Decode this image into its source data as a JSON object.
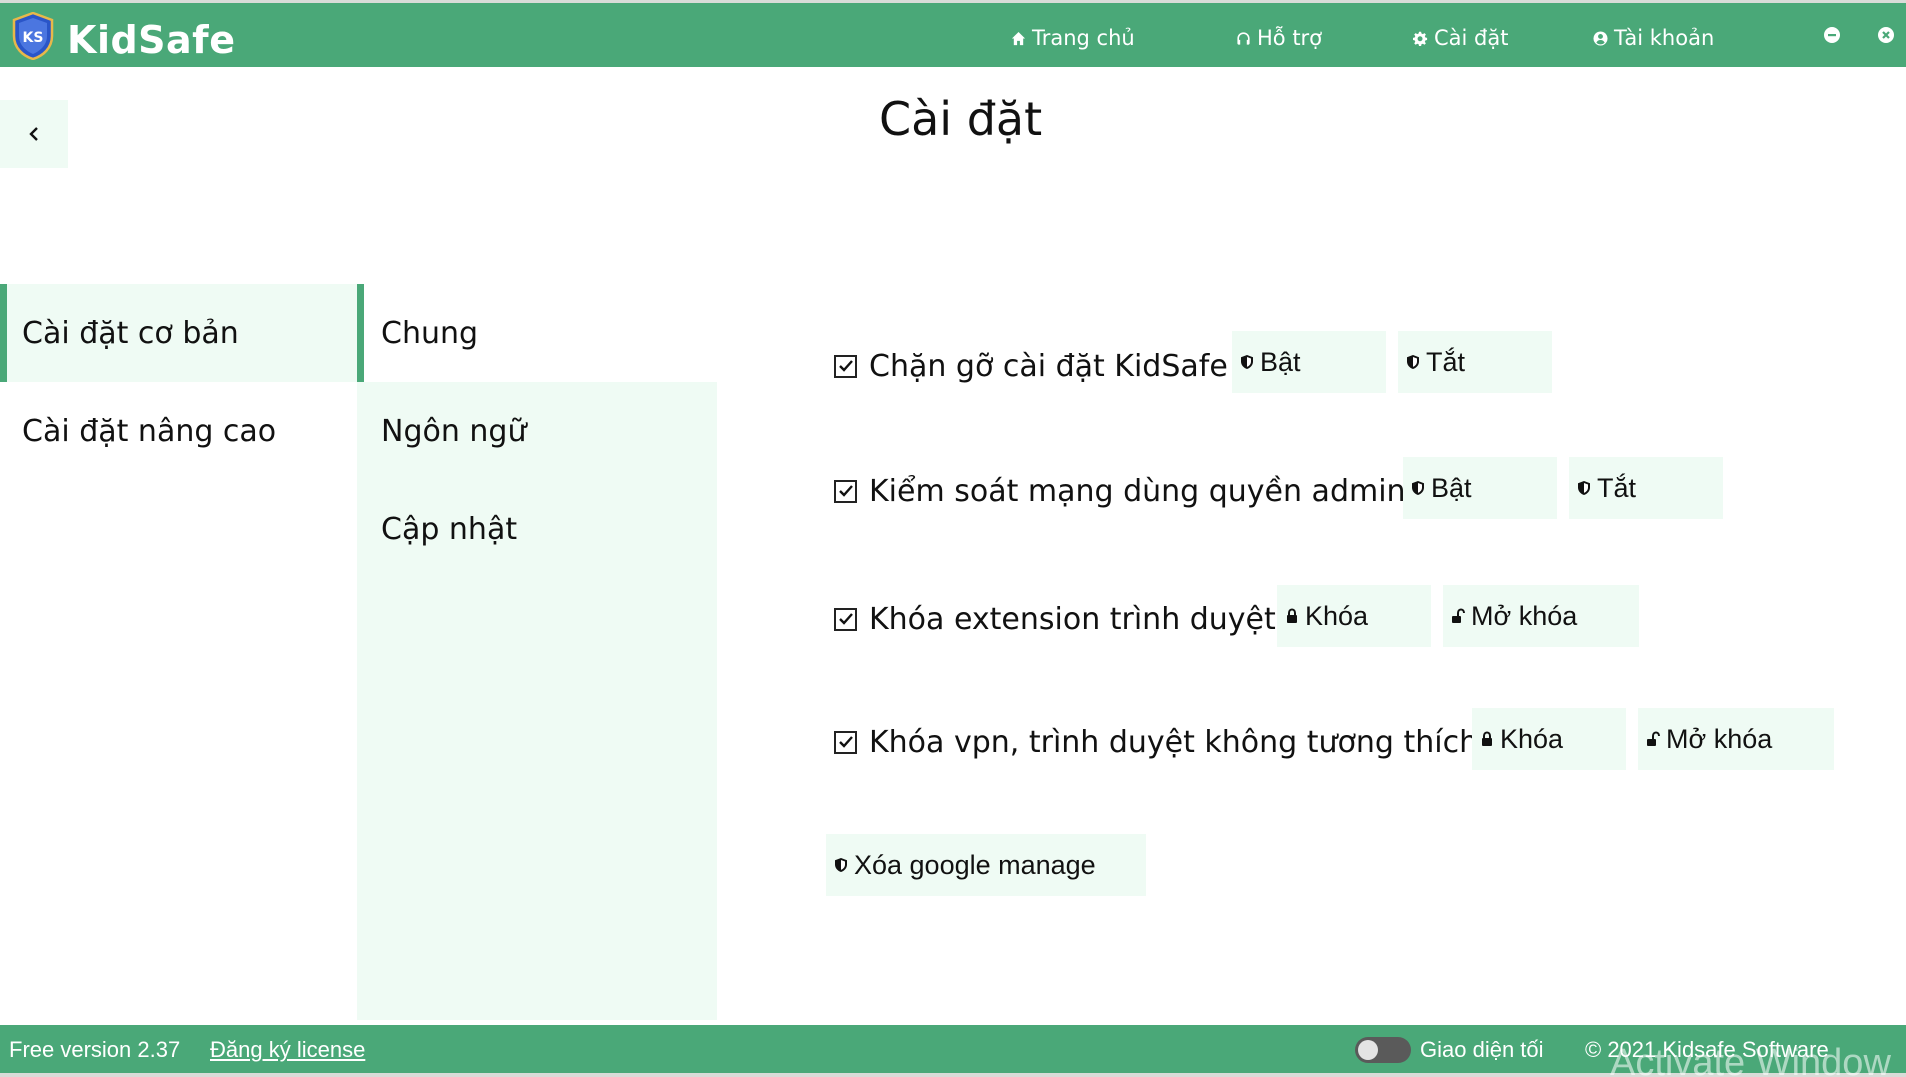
{
  "header": {
    "app_name": "KidSafe",
    "logo_text": "KS",
    "nav": [
      {
        "label": "Trang chủ",
        "icon": "home-icon"
      },
      {
        "label": "Hỗ trợ",
        "icon": "headphones-icon"
      },
      {
        "label": "Cài đặt",
        "icon": "gear-icon"
      },
      {
        "label": "Tài khoản",
        "icon": "user-circle-icon"
      }
    ],
    "window_controls": [
      "minimize-icon",
      "close-icon"
    ]
  },
  "page": {
    "title": "Cài đặt",
    "back_icon": "chevron-left-icon"
  },
  "menu": {
    "items": [
      {
        "label": "Cài đặt cơ bản",
        "active": true
      },
      {
        "label": "Cài đặt nâng cao",
        "active": false
      }
    ]
  },
  "submenu": {
    "items": [
      {
        "label": "Chung",
        "active": true
      },
      {
        "label": "Ngôn ngữ",
        "active": false
      },
      {
        "label": "Cập nhật",
        "active": false
      }
    ]
  },
  "settings": [
    {
      "label": "Chặn gỡ cài đặt KidSafe",
      "checked": true,
      "buttons": [
        {
          "label": "Bật",
          "icon": "shield-icon"
        },
        {
          "label": "Tắt",
          "icon": "shield-icon"
        }
      ]
    },
    {
      "label": "Kiểm soát mạng dùng quyền admin",
      "checked": true,
      "buttons": [
        {
          "label": "Bật",
          "icon": "shield-icon"
        },
        {
          "label": "Tắt",
          "icon": "shield-icon"
        }
      ]
    },
    {
      "label": "Khóa extension trình duyệt",
      "checked": true,
      "buttons": [
        {
          "label": "Khóa",
          "icon": "lock-icon"
        },
        {
          "label": "Mở khóa",
          "icon": "unlock-icon"
        }
      ]
    },
    {
      "label": "Khóa vpn, trình duyệt không tương thích",
      "checked": true,
      "buttons": [
        {
          "label": "Khóa",
          "icon": "lock-icon"
        },
        {
          "label": "Mở khóa",
          "icon": "unlock-icon"
        }
      ]
    }
  ],
  "actions": {
    "clear_google_manage": {
      "label": "Xóa google manage",
      "icon": "shield-icon"
    }
  },
  "footer": {
    "version": "Free version 2.37",
    "license_link": "Đăng ký license",
    "dark_mode_label": "Giao diện tối",
    "dark_mode_on": false,
    "copyright": "© 2021 Kidsafe Software"
  },
  "watermark": "Activate Window",
  "colors": {
    "brand_green": "#4aa878",
    "light_mint": "#effbf4"
  }
}
